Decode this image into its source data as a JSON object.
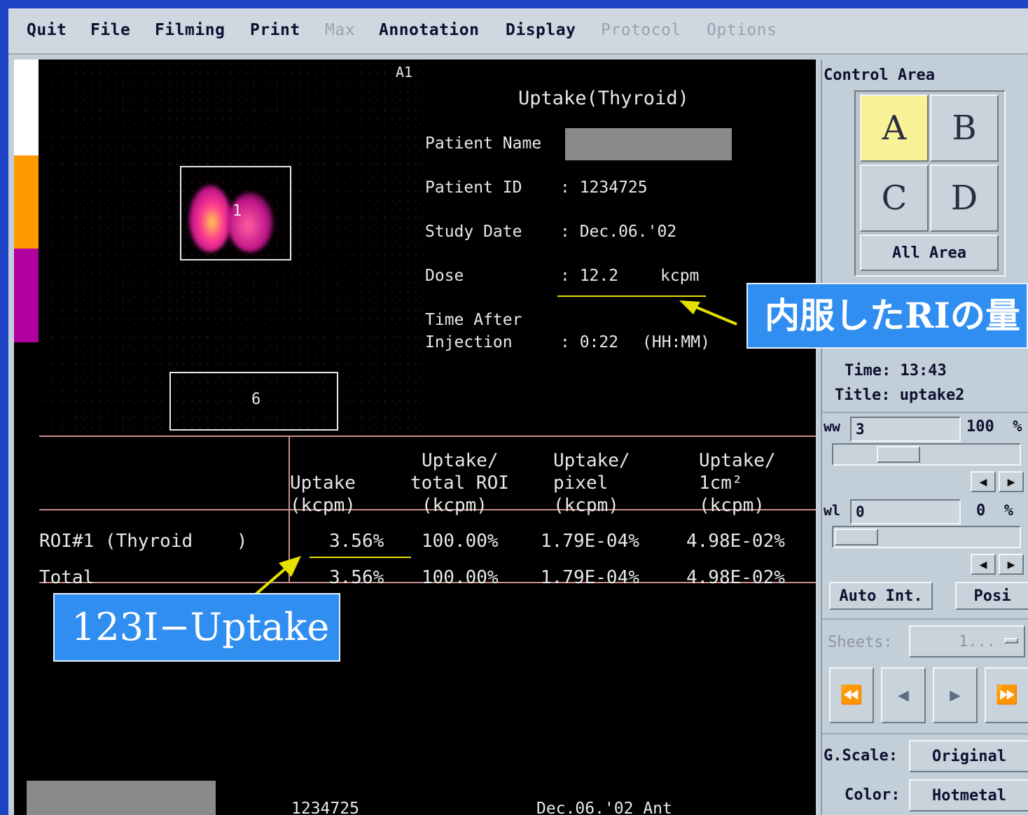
{
  "menu": {
    "items": [
      {
        "label": "Quit",
        "enabled": true
      },
      {
        "label": "File",
        "enabled": true
      },
      {
        "label": "Filming",
        "enabled": true
      },
      {
        "label": "Print",
        "enabled": true
      },
      {
        "label": "Max",
        "enabled": false
      },
      {
        "label": "Annotation",
        "enabled": true
      },
      {
        "label": "Display",
        "enabled": true
      },
      {
        "label": "Protocol",
        "enabled": false
      },
      {
        "label": "Options",
        "enabled": false
      }
    ]
  },
  "viewport": {
    "area_label": "A1",
    "title": "Uptake(Thyroid)",
    "patient_name_label": "Patient Name",
    "patient_id_label": "Patient ID",
    "patient_id_value": ": 1234725",
    "study_date_label": "Study Date",
    "study_date_value": ": Dec.06.'02",
    "dose_label": "Dose",
    "dose_value": ": 12.2",
    "dose_unit": "kcpm",
    "time_after_label_1": "Time After",
    "time_after_label_2": "Injection",
    "time_after_value": ": 0:22",
    "time_after_unit": "(HH:MM)",
    "roi_1_label": "1",
    "roi_6_label": "6",
    "footer_id": "1234725",
    "footer_date": "Dec.06.'02 Ant"
  },
  "table": {
    "headers": [
      {
        "l1": "",
        "l2": "Uptake",
        "l3": "(kcpm)"
      },
      {
        "l1": "Uptake/",
        "l2": "total ROI",
        "l3": "(kcpm)"
      },
      {
        "l1": "Uptake/",
        "l2": "pixel",
        "l3": "(kcpm)"
      },
      {
        "l1": "Uptake/",
        "l2": "1cm²",
        "l3": "(kcpm)"
      }
    ],
    "rows": [
      {
        "label": "ROI#1 (Thyroid    )",
        "values": [
          "3.56%",
          "100.00%",
          "1.79E-04%",
          "4.98E-02%"
        ]
      },
      {
        "label": "Total",
        "values": [
          "3.56%",
          "100.00%",
          "1.79E-04%",
          "4.98E-02%"
        ]
      }
    ]
  },
  "callouts": {
    "dose": "内服したRIの量",
    "uptake": "123I−Uptake"
  },
  "panel": {
    "control_area_label": "Control Area",
    "areas": [
      "A",
      "B",
      "C",
      "D"
    ],
    "selected_area": "A",
    "all_area_label": "All Area",
    "time_text": "Time: 13:43",
    "title_text": "Title: uptake2",
    "ww_label": "ww",
    "ww_value": "3",
    "ww_percent": "100  %",
    "ww_slider_level": 0.3,
    "wl_label": "wl",
    "wl_value": "0",
    "wl_percent": "0  %",
    "wl_slider_level": 0.0,
    "auto_int_label": "Auto Int.",
    "posi_label": "Posi",
    "sheets_label": "Sheets:",
    "sheets_value": "1...",
    "gscale_label": "G.Scale:",
    "gscale_value": "Original",
    "color_label": "Color:",
    "color_value": "Hotmetal"
  },
  "colors": {
    "colorbar": [
      "#ffffff",
      "#ff9a00",
      "#b000a0"
    ],
    "selected_area_bg": "#f8f296",
    "callout_bg": "#2f8ef0",
    "annotation_line": "#e6e000",
    "table_line": "#c98f8a"
  }
}
